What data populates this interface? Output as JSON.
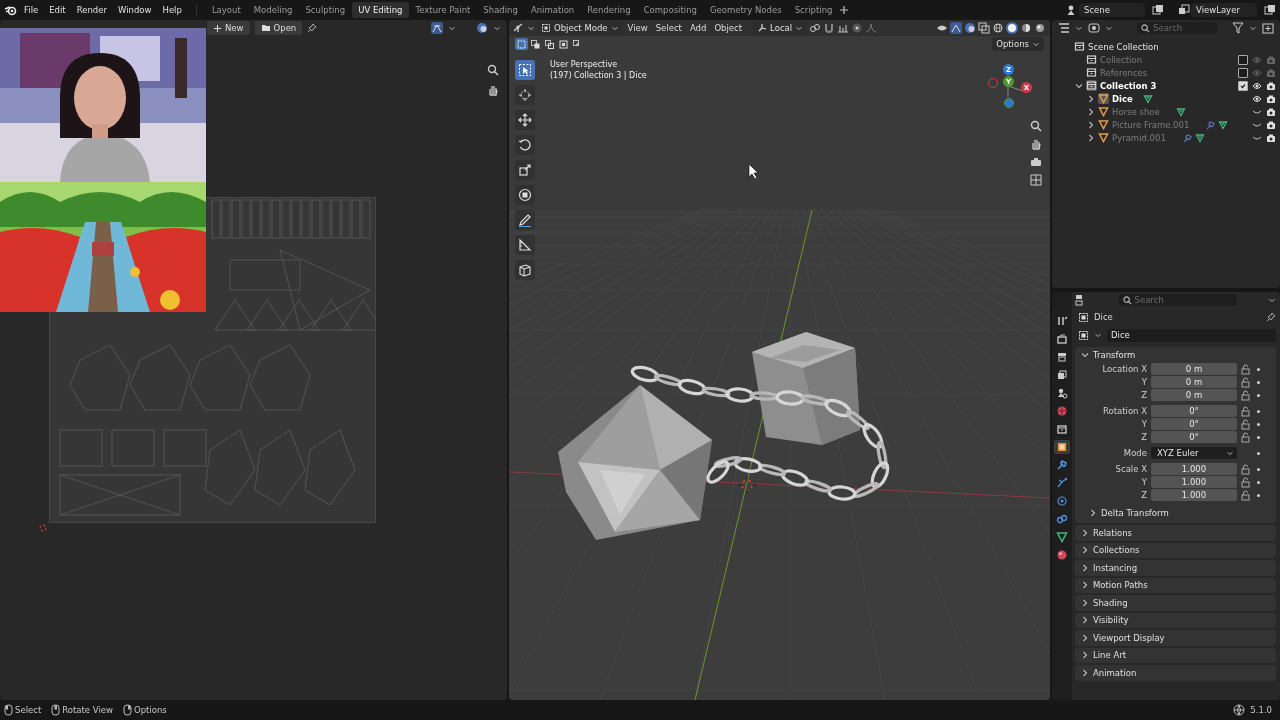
{
  "top_bar": {
    "menus": [
      "File",
      "Edit",
      "Render",
      "Window",
      "Help"
    ],
    "workspaces": [
      {
        "label": "Layout",
        "selected": false
      },
      {
        "label": "Modeling",
        "selected": false
      },
      {
        "label": "Sculpting",
        "selected": false
      },
      {
        "label": "UV Editing",
        "selected": true
      },
      {
        "label": "Texture Paint",
        "selected": false
      },
      {
        "label": "Shading",
        "selected": false
      },
      {
        "label": "Animation",
        "selected": false
      },
      {
        "label": "Rendering",
        "selected": false
      },
      {
        "label": "Compositing",
        "selected": false
      },
      {
        "label": "Geometry Nodes",
        "selected": false
      },
      {
        "label": "Scripting",
        "selected": false
      }
    ],
    "scene": "Scene",
    "view_layer": "ViewLayer"
  },
  "uv_editor": {
    "buttons": [
      "New",
      "Open"
    ]
  },
  "viewport": {
    "mode": "Object Mode",
    "menus": [
      "View",
      "Select",
      "Add",
      "Object"
    ],
    "orientation": "Local",
    "options": "Options",
    "info": [
      "User Perspective",
      "(197) Collection 3 | Dice"
    ],
    "select_modes": [
      {
        "kind": "set",
        "selected": true
      },
      {
        "kind": "extend",
        "selected": false
      },
      {
        "kind": "subtract",
        "selected": false
      },
      {
        "kind": "invert",
        "selected": false
      },
      {
        "kind": "intersect",
        "selected": false
      }
    ],
    "shading": [
      {
        "kind": "wireframe",
        "selected": false
      },
      {
        "kind": "solid",
        "selected": true
      },
      {
        "kind": "material",
        "selected": false
      },
      {
        "kind": "rendered",
        "selected": false
      }
    ],
    "tools": [
      {
        "kind": "select",
        "selected": true
      },
      {
        "kind": "cursor",
        "selected": false
      },
      {
        "kind": "move",
        "selected": false
      },
      {
        "kind": "rotate",
        "selected": false
      },
      {
        "kind": "scale",
        "selected": false
      },
      {
        "kind": "transform",
        "selected": false
      },
      {
        "kind": "annotate",
        "selected": false
      },
      {
        "kind": "measure",
        "selected": false
      },
      {
        "kind": "add-cube",
        "selected": false
      }
    ],
    "gizmo": [
      {
        "label": "Z",
        "color": "#2e78d0"
      },
      {
        "label": "Y",
        "color": "#4f9a30"
      },
      {
        "label": "X",
        "color": "#d03a48"
      }
    ]
  },
  "outliner": {
    "search": {
      "placeholder": "Search"
    },
    "tree": [
      {
        "kind": "scene",
        "label": "Scene Collection",
        "selected": false,
        "children": [
          {
            "kind": "collection",
            "label": "Collection",
            "selected": false,
            "checked": false
          },
          {
            "kind": "collection",
            "label": "References",
            "selected": false,
            "checked": false
          },
          {
            "kind": "collection",
            "label": "Collection 3",
            "selected": true,
            "checked": true,
            "expanded": true,
            "children": [
              {
                "kind": "object",
                "label": "Dice",
                "selected": true,
                "visible": true,
                "expanded": false,
                "modifier": false
              },
              {
                "kind": "object",
                "label": "Horse shoe",
                "selected": false,
                "visible": false,
                "expanded": false,
                "modifier": false
              },
              {
                "kind": "object",
                "label": "Picture Frame.001",
                "selected": false,
                "visible": false,
                "expanded": false,
                "modifier": true
              },
              {
                "kind": "object",
                "label": "Pyramid.001",
                "selected": false,
                "visible": false,
                "expanded": false,
                "modifier": true
              }
            ]
          }
        ]
      }
    ]
  },
  "properties": {
    "search": {
      "placeholder": "Search"
    },
    "object": "Dice",
    "data": "Dice",
    "tabs": [
      {
        "kind": "tool",
        "selected": false
      },
      {
        "kind": "render",
        "selected": false
      },
      {
        "kind": "output",
        "selected": false
      },
      {
        "kind": "view-layer",
        "selected": false
      },
      {
        "kind": "scene",
        "selected": false
      },
      {
        "kind": "world",
        "selected": false
      },
      {
        "kind": "collection",
        "selected": false
      },
      {
        "kind": "object",
        "selected": true
      },
      {
        "kind": "modifiers",
        "selected": false
      },
      {
        "kind": "particles",
        "selected": false
      },
      {
        "kind": "physics",
        "selected": false
      },
      {
        "kind": "constraints",
        "selected": false
      },
      {
        "kind": "data",
        "selected": false
      },
      {
        "kind": "material",
        "selected": false
      }
    ],
    "transform": {
      "label": "Transform",
      "expanded": true,
      "groups": [
        [
          {
            "kind": "field",
            "label": "Location X",
            "value": "0 m"
          },
          {
            "kind": "field",
            "label": "Y",
            "value": "0 m"
          },
          {
            "kind": "field",
            "label": "Z",
            "value": "0 m"
          }
        ],
        [
          {
            "kind": "field",
            "label": "Rotation X",
            "value": "0°"
          },
          {
            "kind": "field",
            "label": "Y",
            "value": "0°"
          },
          {
            "kind": "field",
            "label": "Z",
            "value": "0°"
          }
        ],
        [
          {
            "kind": "dropdown",
            "label": "Mode",
            "value": "XYZ Euler"
          }
        ],
        [
          {
            "kind": "field",
            "label": "Scale X",
            "value": "1.000"
          },
          {
            "kind": "field",
            "label": "Y",
            "value": "1.000"
          },
          {
            "kind": "field",
            "label": "Z",
            "value": "1.000"
          }
        ]
      ],
      "subpanels": [
        {
          "label": "Delta Transform",
          "expanded": false
        }
      ]
    },
    "panels": [
      {
        "label": "Relations",
        "expanded": false
      },
      {
        "label": "Collections",
        "expanded": false
      },
      {
        "label": "Instancing",
        "expanded": false
      },
      {
        "label": "Motion Paths",
        "expanded": false
      },
      {
        "label": "Shading",
        "expanded": false
      },
      {
        "label": "Visibility",
        "expanded": false
      },
      {
        "label": "Viewport Display",
        "expanded": false
      },
      {
        "label": "Line Art",
        "expanded": false
      },
      {
        "label": "Animation",
        "expanded": false
      }
    ]
  },
  "status_bar": {
    "hints": [
      "Select",
      "Rotate View",
      "Options"
    ],
    "version": "5.1.0"
  }
}
